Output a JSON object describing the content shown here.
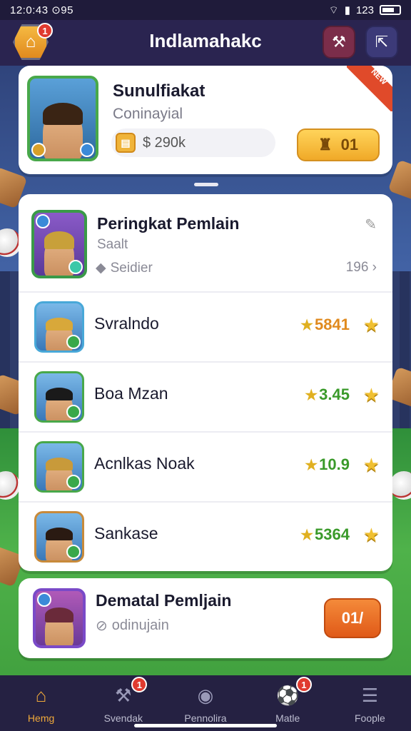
{
  "status_bar": {
    "time": "12:0:43 ⊙95",
    "battery": "123"
  },
  "header": {
    "title": "Indlamahakc",
    "home_badge": "1"
  },
  "profile": {
    "name": "Sunulfiakat",
    "subtitle": "Coninayial",
    "coins": "$ 290k",
    "reward_value": "01",
    "ribbon_text": "NEW"
  },
  "leaderboard": {
    "title": "Peringkat Pemlain",
    "subtitle": "Saalt",
    "filter_label": "Seidier",
    "count": "196 ›",
    "rows": [
      {
        "name": "Svralndo",
        "score": "5841",
        "color": "#e08a1e",
        "border": "#48a8d8",
        "hair": "#d8a83a"
      },
      {
        "name": "Boa Mzan",
        "score": "3.45",
        "color": "#3a9a2a",
        "border": "#48a84a",
        "hair": "#1a1a1a"
      },
      {
        "name": "Acnlkas Noak",
        "score": "10.9",
        "color": "#3a9a2a",
        "border": "#48a84a",
        "hair": "#c89a3a"
      },
      {
        "name": "Sankase",
        "score": "5364",
        "color": "#3a9a2a",
        "border": "#c88a3a",
        "hair": "#2a1a12"
      }
    ]
  },
  "bottom": {
    "title": "Dematal Pemljain",
    "subtitle": "odinujain",
    "button": "01/"
  },
  "tabs": [
    {
      "label": "Hemg",
      "icon": "home-icon",
      "glyph": "⌂",
      "active": true,
      "badge": ""
    },
    {
      "label": "Svendak",
      "icon": "hammer-icon",
      "glyph": "⚒",
      "active": false,
      "badge": "1"
    },
    {
      "label": "Pennolira",
      "icon": "shield-icon",
      "glyph": "◉",
      "active": false,
      "badge": ""
    },
    {
      "label": "Matle",
      "icon": "ball-icon",
      "glyph": "⚽",
      "active": false,
      "badge": "1"
    },
    {
      "label": "Foople",
      "icon": "menu-icon",
      "glyph": "☰",
      "active": false,
      "badge": ""
    }
  ]
}
